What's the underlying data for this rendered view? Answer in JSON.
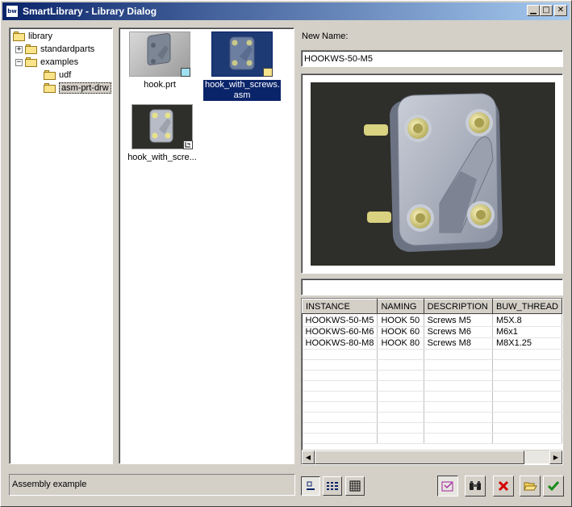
{
  "window": {
    "title": "SmartLibrary - Library Dialog",
    "app_icon_text": "bw"
  },
  "tree": {
    "items": [
      {
        "label": "library",
        "expander": ""
      },
      {
        "label": "standardparts",
        "expander": "+"
      },
      {
        "label": "examples",
        "expander": "−"
      },
      {
        "label": "udf",
        "expander": ""
      },
      {
        "label": "asm-prt-drw",
        "expander": "",
        "selected": true
      }
    ]
  },
  "files": [
    {
      "label": "hook.prt",
      "badge": "part-icon",
      "selected": false
    },
    {
      "label": "hook_with_screws.asm",
      "label_line1": "hook_with_screws.",
      "label_line2": "asm",
      "badge": "assembly-icon",
      "selected": true
    },
    {
      "label": "hook_with_scre...",
      "badge": "drawing-icon",
      "selected": false
    }
  ],
  "new_name": {
    "label": "New Name:",
    "value": "HOOKWS-50-M5"
  },
  "filter": {
    "value": ""
  },
  "table": {
    "columns": [
      "INSTANCE",
      "NAMING",
      "DESCRIPTION",
      "BUW_THREAD"
    ],
    "rows": [
      [
        "HOOKWS-50-M5",
        "HOOK 50",
        "Screws M5",
        "M5X.8"
      ],
      [
        "HOOKWS-60-M6",
        "HOOK 60",
        "Screws M6",
        "M6x1"
      ],
      [
        "HOOKWS-80-M8",
        "HOOK 80",
        "Screws M8",
        "M8X1.25"
      ]
    ]
  },
  "status": {
    "text": "Assembly example"
  },
  "toolbar": {
    "view_icons": [
      "large-icons-view-icon",
      "list-view-icon",
      "details-view-icon"
    ],
    "actions": [
      "edit-icon",
      "search-icon",
      "cancel-icon",
      "open-folder-icon",
      "ok-icon"
    ]
  },
  "colors": {
    "title_start": "#0a246a",
    "title_end": "#a6caf0",
    "selection": "#0a246a",
    "preview_bg": "#2e2e2a"
  }
}
